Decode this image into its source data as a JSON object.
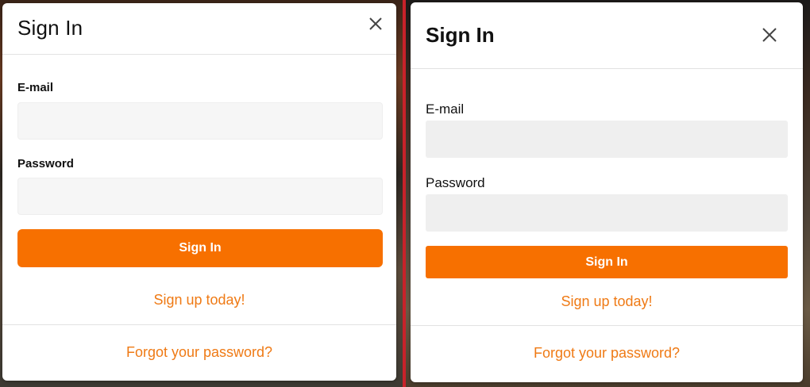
{
  "left_modal": {
    "title": "Sign In",
    "close_icon": "close-icon",
    "email_label": "E-mail",
    "email_value": "",
    "password_label": "Password",
    "password_value": "",
    "submit_label": "Sign In",
    "signup_link": "Sign up today!",
    "forgot_link": "Forgot your password?"
  },
  "right_modal": {
    "title": "Sign In",
    "close_icon": "close-icon",
    "email_label": "E-mail",
    "email_value": "",
    "password_label": "Password",
    "password_value": "",
    "submit_label": "Sign In",
    "signup_link": "Sign up today!",
    "forgot_link": "Forgot your password?"
  },
  "colors": {
    "accent": "#F77000",
    "link": "#EF7A15",
    "divider": "#C8222A"
  }
}
